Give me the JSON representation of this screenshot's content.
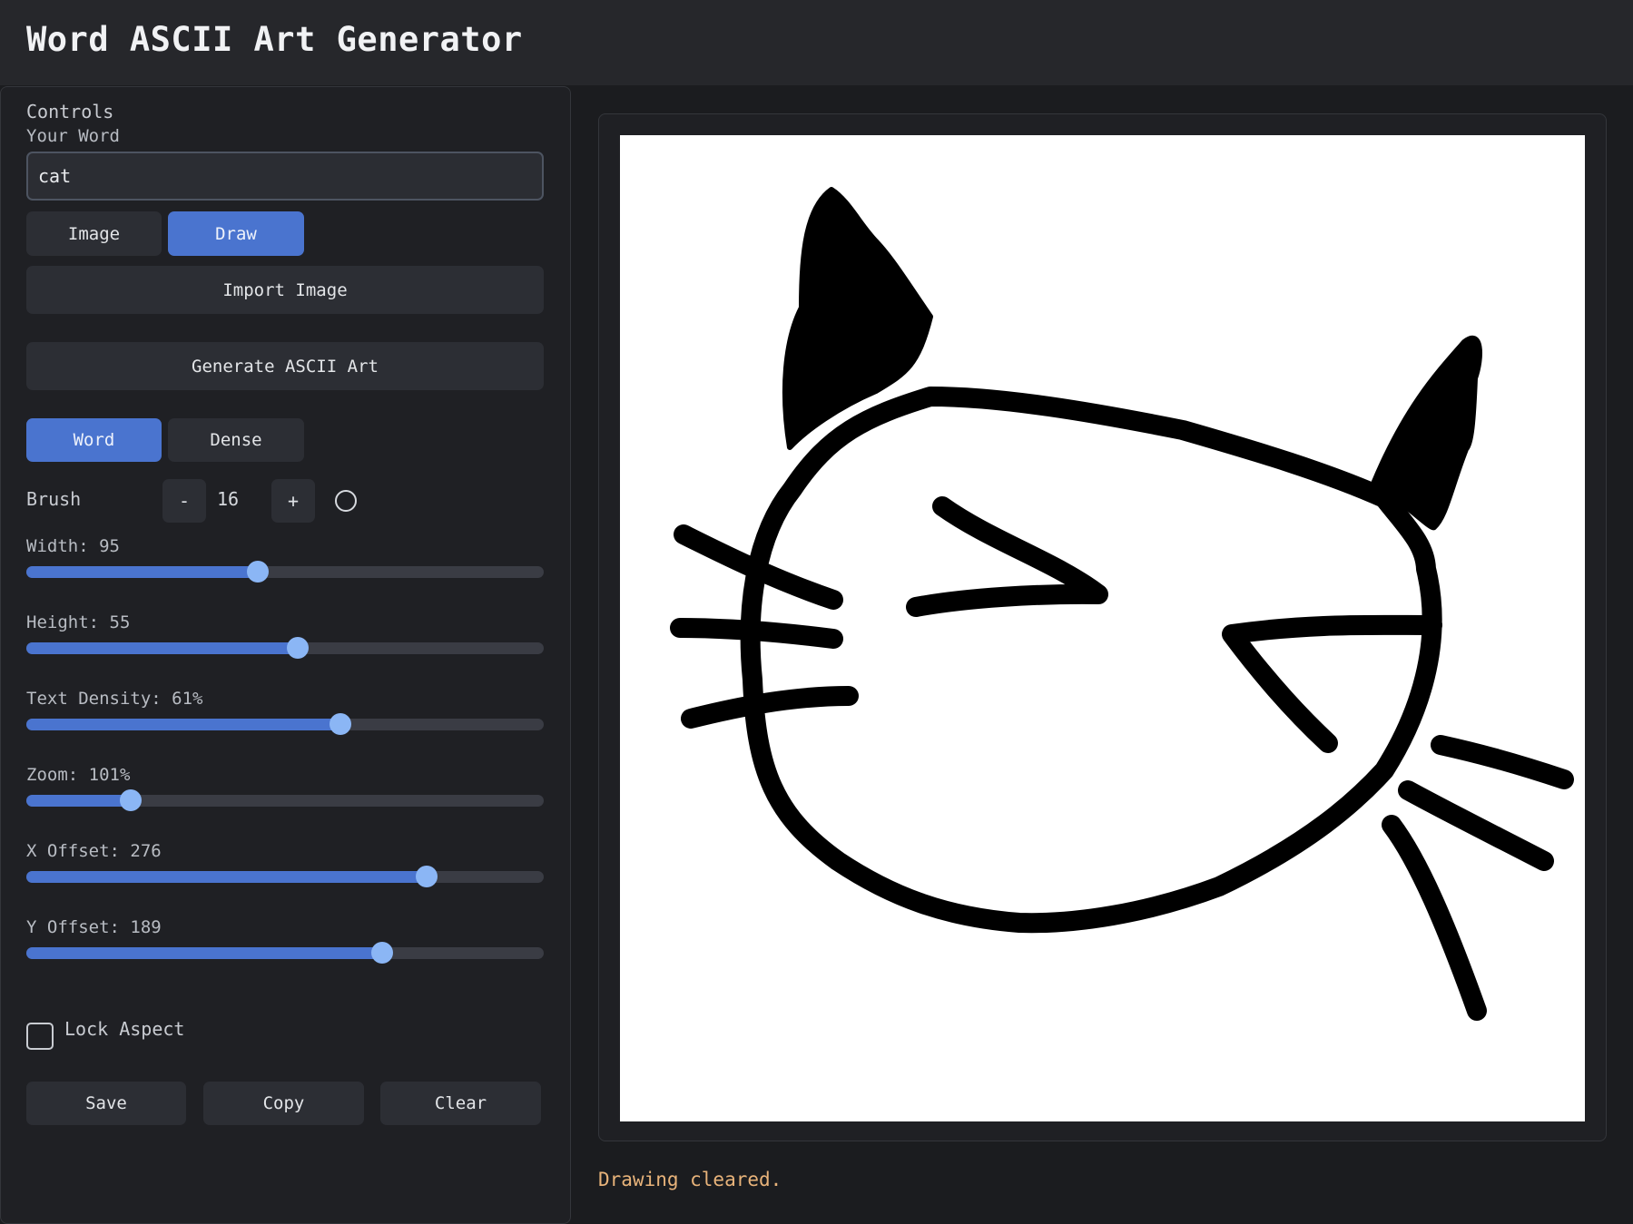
{
  "header": {
    "title": "Word ASCII Art Generator"
  },
  "controls": {
    "heading": "Controls",
    "word_label": "Your Word",
    "word_value": "cat",
    "source_modes": [
      {
        "label": "Image",
        "active": false
      },
      {
        "label": "Draw",
        "active": true
      }
    ],
    "import_label": "Import Image",
    "generate_label": "Generate ASCII Art",
    "render_modes": [
      {
        "label": "Word",
        "active": true
      },
      {
        "label": "Dense",
        "active": false
      }
    ],
    "brush": {
      "label": "Brush",
      "minus": "-",
      "value": "16",
      "plus": "+"
    },
    "sliders": [
      {
        "label": "Width: 95",
        "fraction": 0.447
      },
      {
        "label": "Height: 55",
        "fraction": 0.525
      },
      {
        "label": "Text Density: 61%",
        "fraction": 0.607
      },
      {
        "label": "Zoom: 101%",
        "fraction": 0.202
      },
      {
        "label": "X Offset: 276",
        "fraction": 0.773
      },
      {
        "label": "Y Offset: 189",
        "fraction": 0.687
      }
    ],
    "lock_aspect": {
      "label": "Lock Aspect",
      "checked": false
    },
    "actions": {
      "save": "Save",
      "copy": "Copy",
      "clear": "Clear"
    }
  },
  "status": {
    "message": "Drawing cleared."
  },
  "colors": {
    "accent": "#4a74cf",
    "thumb": "#8bb6f5",
    "status": "#e8b37a",
    "panel": "#1f2024"
  }
}
